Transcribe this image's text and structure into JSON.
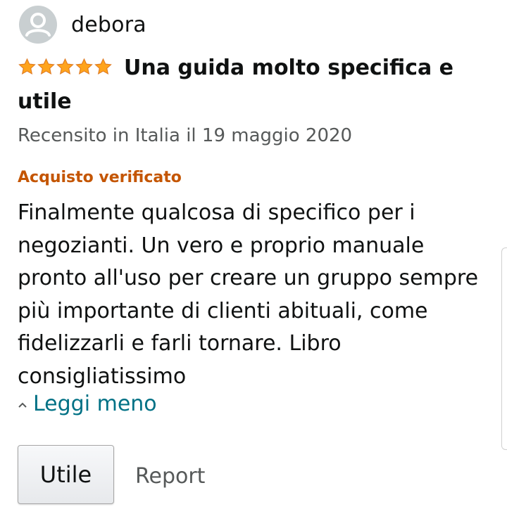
{
  "review": {
    "author": "debora",
    "avatar_icon": "user-avatar-icon",
    "rating": 5,
    "rating_max": 5,
    "star_color": "#ffa41c",
    "title": "Una guida molto specifica e utile",
    "date": "Recensito in Italia il 19 maggio 2020",
    "verified_label": "Acquisto verificato",
    "verified_color": "#c45500",
    "body": "Finalmente qualcosa di specifico per i\nnegozianti. Un vero e proprio manuale\npronto all'uso per creare un gruppo sempre\npiù importante di clienti abituali, come\nfidelizzarli e farli tornare. Libro\nconsigliatissimo",
    "read_less_label": "Leggi meno",
    "link_color": "#007185"
  },
  "actions": {
    "helpful_label": "Utile",
    "report_label": "Report"
  }
}
